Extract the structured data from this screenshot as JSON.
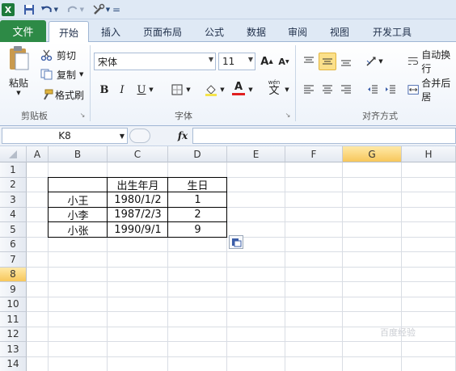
{
  "quick_access": {
    "logo": "X",
    "customize_label": "="
  },
  "tabs": [
    "文件",
    "开始",
    "插入",
    "页面布局",
    "公式",
    "数据",
    "审阅",
    "视图",
    "开发工具"
  ],
  "ribbon": {
    "clipboard": {
      "paste_label": "粘贴",
      "cut_label": "剪切",
      "copy_label": "复制",
      "format_painter_label": "格式刷",
      "group_label": "剪贴板"
    },
    "font": {
      "font_name": "宋体",
      "font_size": "11",
      "grow_label": "A",
      "shrink_label": "A",
      "bold_label": "B",
      "italic_label": "I",
      "underline_label": "U",
      "font_color_label": "A",
      "phonetic_label": "文",
      "group_label": "字体"
    },
    "alignment": {
      "wrap_text_label": "自动换行",
      "merge_label": "合并后居",
      "group_label": "对齐方式"
    }
  },
  "formula_bar": {
    "name_box": "K8",
    "fx_label": "fx",
    "formula": ""
  },
  "sheet": {
    "columns": [
      "A",
      "B",
      "C",
      "D",
      "E",
      "F",
      "G",
      "H"
    ],
    "selected_column": "G",
    "rows": [
      "1",
      "2",
      "3",
      "4",
      "5",
      "6",
      "7",
      "8",
      "9",
      "10",
      "11",
      "12",
      "13",
      "14"
    ],
    "selected_row": "8",
    "table_header": {
      "birth_label": "出生年月",
      "birthday_label": "生日"
    },
    "table_rows": [
      {
        "name": "小王",
        "birth": "1980/1/2",
        "day": "1"
      },
      {
        "name": "小李",
        "birth": "1987/2/3",
        "day": "2"
      },
      {
        "name": "小张",
        "birth": "1990/9/1",
        "day": "9"
      }
    ]
  },
  "watermark": "百度经验"
}
